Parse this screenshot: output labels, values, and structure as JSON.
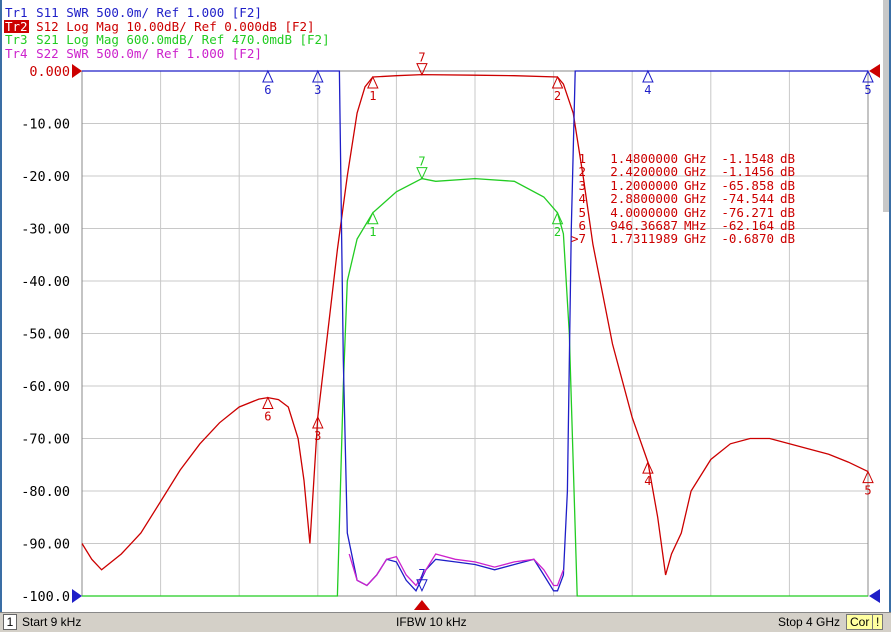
{
  "traces": [
    {
      "tag": "Tr1",
      "text": " S11 SWR 500.0m/ Ref 1.000 [F2]",
      "color": "#1e1ec8",
      "active": false
    },
    {
      "tag": "Tr2",
      "text": " S12 Log Mag 10.00dB/ Ref 0.000dB [F2]",
      "color": "#cc0000",
      "active": true
    },
    {
      "tag": "Tr3",
      "text": " S21 Log Mag 600.0mdB/ Ref 470.0mdB [F2]",
      "color": "#22cc22",
      "active": false
    },
    {
      "tag": "Tr4",
      "text": " S22 SWR 500.0m/ Ref 1.000 [F2]",
      "color": "#cc22cc",
      "active": false
    }
  ],
  "markers": [
    {
      "id": "1",
      "freq": "1.4800000",
      "unit": "GHz",
      "value": "-1.1548",
      "vunit": "dB"
    },
    {
      "id": "2",
      "freq": "2.4200000",
      "unit": "GHz",
      "value": "-1.1456",
      "vunit": "dB"
    },
    {
      "id": "3",
      "freq": "1.2000000",
      "unit": "GHz",
      "value": "-65.858",
      "vunit": "dB"
    },
    {
      "id": "4",
      "freq": "2.8800000",
      "unit": "GHz",
      "value": "-74.544",
      "vunit": "dB"
    },
    {
      "id": "5",
      "freq": "4.0000000",
      "unit": "GHz",
      "value": "-76.271",
      "vunit": "dB"
    },
    {
      "id": "6",
      "freq": "946.36687",
      "unit": "MHz",
      "value": "-62.164",
      "vunit": "dB"
    },
    {
      "id": ">7",
      "freq": "1.7311989",
      "unit": "GHz",
      "value": "-0.6870",
      "vunit": "dB"
    }
  ],
  "status": {
    "channel": "1",
    "start": "Start 9 kHz",
    "ifbw": "IFBW 10 kHz",
    "stop": "Stop 4 GHz",
    "cor": "Cor",
    "alert": "!"
  },
  "colors": {
    "s11": "#1e1ec8",
    "s12": "#cc0000",
    "s21": "#22cc22",
    "s22": "#cc22cc",
    "grid": "#c8c8c8",
    "axis": "#000000"
  },
  "chart_data": {
    "type": "line",
    "xlim": [
      9e-06,
      4.0
    ],
    "ylim": [
      -100,
      0
    ],
    "grid": true,
    "yticks": [
      "0.000",
      "-10.00",
      "-20.00",
      "-30.00",
      "-40.00",
      "-50.00",
      "-60.00",
      "-70.00",
      "-80.00",
      "-90.00",
      "-100.0"
    ],
    "series": [
      {
        "name": "Tr2",
        "color": "#cc0000",
        "x": [
          9e-06,
          0.05,
          0.1,
          0.2,
          0.3,
          0.4,
          0.5,
          0.6,
          0.7,
          0.8,
          0.9,
          0.946,
          1.0,
          1.05,
          1.1,
          1.13,
          1.16,
          1.2,
          1.25,
          1.3,
          1.35,
          1.4,
          1.44,
          1.48,
          1.6,
          1.73,
          2.0,
          2.2,
          2.42,
          2.45,
          2.5,
          2.55,
          2.6,
          2.7,
          2.8,
          2.88,
          2.93,
          2.97,
          3.0,
          3.05,
          3.1,
          3.2,
          3.3,
          3.4,
          3.5,
          3.6,
          3.7,
          3.8,
          3.9,
          4.0
        ],
        "y": [
          -90,
          -93,
          -95,
          -92,
          -88,
          -82,
          -76,
          -71,
          -67,
          -64,
          -62.5,
          -62.2,
          -62.6,
          -64,
          -70,
          -78,
          -90,
          -65.9,
          -50,
          -34,
          -20,
          -8,
          -3,
          -1.15,
          -0.9,
          -0.69,
          -0.8,
          -0.9,
          -1.15,
          -2.5,
          -8,
          -20,
          -33,
          -52,
          -66,
          -74.5,
          -85,
          -96,
          -92,
          -88,
          -80,
          -74,
          -71,
          -70,
          -70,
          -71,
          -72,
          -73,
          -74.5,
          -76.3
        ]
      },
      {
        "name": "Tr3",
        "color": "#22cc22",
        "x": [
          9e-06,
          1.3,
          1.33,
          1.35,
          1.4,
          1.48,
          1.6,
          1.73,
          1.8,
          2.0,
          2.2,
          2.35,
          2.42,
          2.45,
          2.48,
          2.52,
          4.0
        ],
        "y": [
          -100,
          -100,
          -60,
          -40,
          -32,
          -27,
          -23,
          -20.5,
          -21,
          -20.5,
          -21,
          -24,
          -27,
          -31,
          -50,
          -100,
          -100
        ]
      },
      {
        "name": "Tr1",
        "color": "#1e1ec8",
        "x": [
          9e-06,
          1.31,
          1.33,
          1.35,
          1.4,
          1.45,
          1.5,
          1.55,
          1.6,
          1.65,
          1.7,
          1.75,
          1.8,
          1.9,
          2.0,
          2.1,
          2.2,
          2.3,
          2.35,
          2.4,
          2.42,
          2.45,
          2.47,
          2.49,
          2.51,
          4.0
        ],
        "y": [
          0,
          0,
          -55,
          -88,
          -97,
          -98,
          -96,
          -93,
          -93.5,
          -97,
          -99,
          -95,
          -93,
          -93.5,
          -94,
          -95,
          -94,
          -93,
          -96,
          -99,
          -99,
          -96,
          -80,
          -30,
          0,
          0
        ]
      },
      {
        "name": "Tr4",
        "color": "#cc22cc",
        "x": [
          1.36,
          1.4,
          1.45,
          1.5,
          1.55,
          1.6,
          1.65,
          1.7,
          1.75,
          1.8,
          1.9,
          2.0,
          2.1,
          2.2,
          2.3,
          2.35,
          2.4,
          2.42,
          2.45
        ],
        "y": [
          -92,
          -97,
          -98,
          -96,
          -93,
          -92.5,
          -96,
          -98,
          -95,
          -92,
          -93,
          -93.5,
          -94.5,
          -93.5,
          -93,
          -95,
          -98,
          -98,
          -95
        ]
      }
    ]
  }
}
